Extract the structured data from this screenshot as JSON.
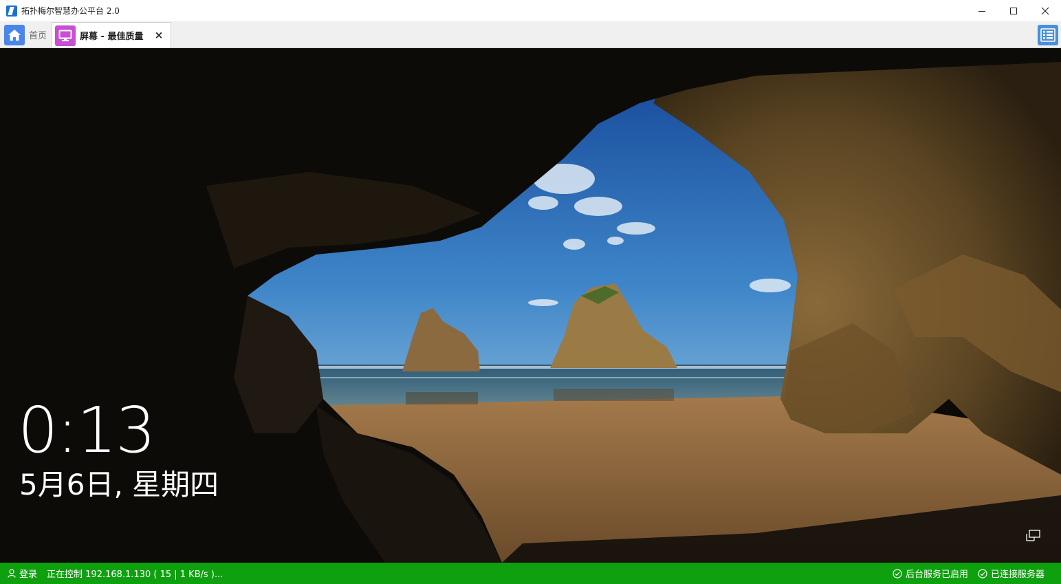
{
  "window": {
    "title": "拓扑梅尔智慧办公平台 2.0"
  },
  "tabs": {
    "home_label": "首页",
    "screen_label": "屏幕 - 最佳质量",
    "close_glyph": "×"
  },
  "lock_screen": {
    "time": "0:13",
    "date": "5月6日, 星期四"
  },
  "statusbar": {
    "login_label": "登录",
    "control_text": "正在控制 192.168.1.130 ( 15 | 1 KB/s )...",
    "service_status": "后台服务已启用",
    "server_status": "已连接服务器"
  },
  "colors": {
    "status_green": "#0fa00f",
    "home_icon_blue": "#4a86e8",
    "screen_icon_magenta": "#c84fd1",
    "menu_button_blue": "#4a90d9"
  },
  "icons": [
    "app-logo-icon",
    "home-icon",
    "monitor-icon",
    "list-menu-icon",
    "user-icon",
    "check-circle-icon",
    "network-icon",
    "minimize-icon",
    "maximize-icon",
    "close-icon"
  ]
}
